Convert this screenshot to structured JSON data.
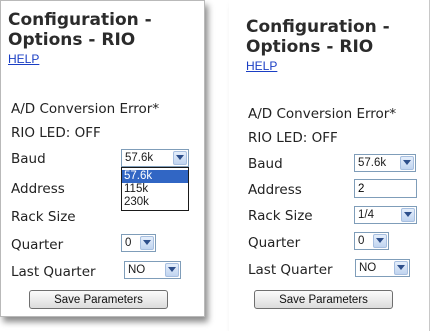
{
  "title_line1": "Configuration -",
  "title_line2": "Options - RIO",
  "help_link": "HELP",
  "ad_error": "A/D Conversion Error*",
  "led_status": "RIO LED: OFF",
  "labels": {
    "baud": "Baud",
    "address": "Address",
    "rack_size": "Rack Size",
    "quarter": "Quarter",
    "last_quarter": "Last Quarter"
  },
  "left": {
    "baud_value": "57.6k",
    "baud_options": [
      "57.6k",
      "115k",
      "230k"
    ],
    "quarter_value": "0",
    "last_quarter_value": "NO"
  },
  "right": {
    "baud_value": "57.6k",
    "address_value": "2",
    "rack_size_value": "1/4",
    "quarter_value": "0",
    "last_quarter_value": "NO"
  },
  "save_button": "Save Parameters",
  "colors": {
    "link": "#1a3ec4",
    "selected_option": "#3166c4"
  }
}
